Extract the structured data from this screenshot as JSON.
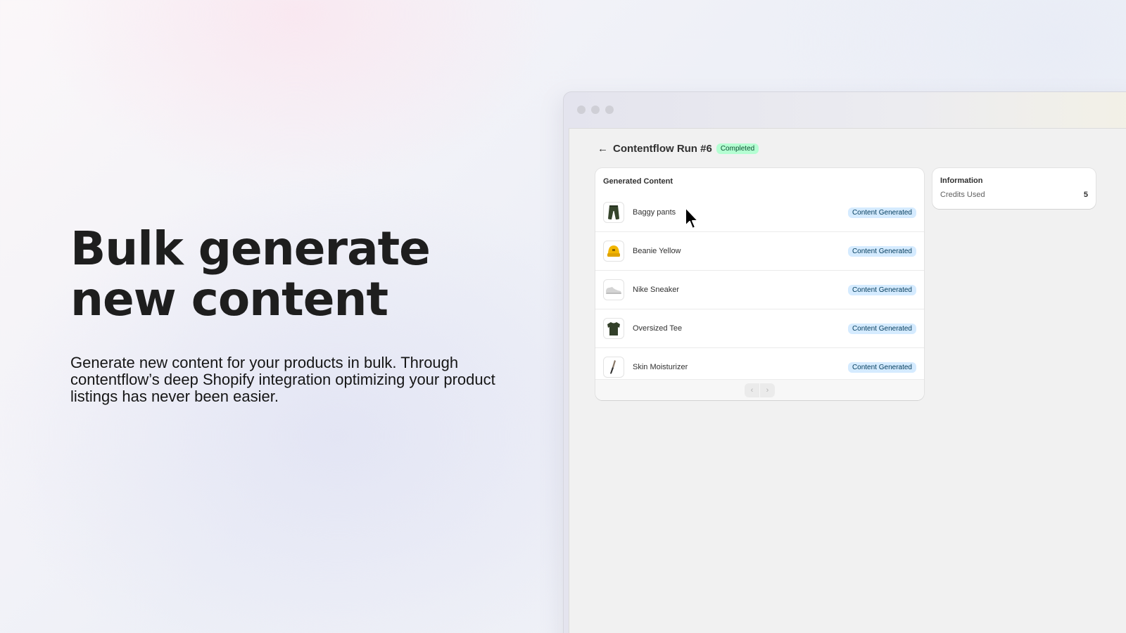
{
  "hero": {
    "title": "Bulk generate new content",
    "description": "Generate new content for your products in bulk. Through contentflow’s deep Shopify integration optimizing your product listings has never been easier."
  },
  "window": {
    "header": {
      "title": "Contentflow Run #6",
      "status": "Completed"
    },
    "generated": {
      "title": "Generated Content",
      "items": [
        {
          "name": "Baggy pants",
          "status": "Content Generated",
          "icon": "pants-icon"
        },
        {
          "name": "Beanie Yellow",
          "status": "Content Generated",
          "icon": "beanie-icon"
        },
        {
          "name": "Nike Sneaker",
          "status": "Content Generated",
          "icon": "sneaker-icon"
        },
        {
          "name": "Oversized Tee",
          "status": "Content Generated",
          "icon": "tshirt-icon"
        },
        {
          "name": "Skin Moisturizer",
          "status": "Content Generated",
          "icon": "bottle-icon"
        }
      ],
      "pager": {
        "prev": "‹",
        "next": "›"
      }
    },
    "info": {
      "title": "Information",
      "credits_label": "Credits Used",
      "credits_value": "5"
    }
  },
  "colors": {
    "completed_badge_bg": "#b4fed2",
    "content_badge_bg": "#d5ebff",
    "text_primary": "#303030"
  }
}
